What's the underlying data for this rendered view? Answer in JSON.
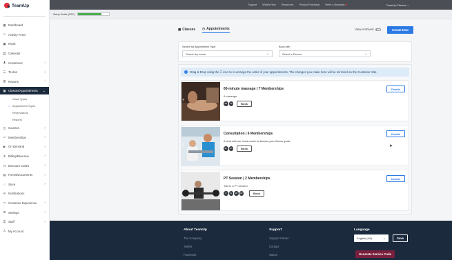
{
  "brand": {
    "name": "TeamUp"
  },
  "sidebar": {
    "items": [
      {
        "icon": "dashboard-icon",
        "glyph": "▦",
        "label": "Dashboard",
        "chev": false
      },
      {
        "icon": "activity-icon",
        "glyph": "∿",
        "label": "Activity Feed",
        "chev": false
      },
      {
        "icon": "kiosk-icon",
        "glyph": "▣",
        "label": "Kiosk",
        "chev": false
      },
      {
        "icon": "calendar-icon",
        "glyph": "▤",
        "label": "Calendar",
        "chev": false
      },
      {
        "icon": "customers-icon",
        "glyph": "♟",
        "label": "Customers",
        "chev": true
      },
      {
        "icon": "todos-icon",
        "glyph": "☰",
        "label": "To-dos",
        "chev": true
      },
      {
        "icon": "reports-icon",
        "glyph": "▥",
        "label": "Reports",
        "chev": true
      },
      {
        "icon": "classes-icon",
        "glyph": "▦",
        "label": "Classes/Appointments",
        "chev": true,
        "active": true
      }
    ],
    "sub_items": [
      {
        "label": "Class Types",
        "checked": false
      },
      {
        "label": "Appointment Types",
        "checked": true
      },
      {
        "label": "Reservations",
        "checked": false
      },
      {
        "label": "Reports",
        "checked": false
      }
    ],
    "items_after": [
      {
        "icon": "courses-icon",
        "glyph": "◫",
        "label": "Courses",
        "chev": true
      },
      {
        "icon": "memberships-icon",
        "glyph": "▭",
        "label": "Memberships",
        "chev": true
      },
      {
        "icon": "on-demand-icon",
        "glyph": "▶",
        "label": "On Demand",
        "chev": true
      },
      {
        "icon": "billing-icon",
        "glyph": "$",
        "label": "Billing/Revenue",
        "chev": true
      },
      {
        "icon": "discount-icon",
        "glyph": "%",
        "label": "Discount Codes",
        "chev": true
      },
      {
        "icon": "forms-icon",
        "glyph": "▤",
        "label": "Forms/Documents",
        "chev": true
      },
      {
        "icon": "store-icon",
        "glyph": "⌂",
        "label": "Store",
        "chev": true
      },
      {
        "icon": "notifications-icon",
        "glyph": "✉",
        "label": "Notifications",
        "chev": false
      },
      {
        "icon": "customer-experience-icon",
        "glyph": "▭",
        "label": "Customer Experience",
        "chev": true
      },
      {
        "icon": "settings-icon",
        "glyph": "⚙",
        "label": "Settings",
        "chev": true
      },
      {
        "icon": "staff-icon",
        "glyph": "⚿",
        "label": "Staff",
        "chev": true
      },
      {
        "icon": "account-icon",
        "glyph": "♙",
        "label": "My Account",
        "chev": false
      }
    ]
  },
  "topbar": {
    "links": [
      "Support",
      "What's New",
      "Resources",
      "Product Feedback",
      "Refer a Business"
    ],
    "account": "TeamUp Fitness"
  },
  "setup": {
    "label": "Setup Guide (9/12)",
    "progress": 0.75,
    "progress_color": "#4cae4f"
  },
  "tabs": {
    "classes": "Classes",
    "appointments": "Appointments"
  },
  "archived_label": "View Archived",
  "create_label": "Create New",
  "filters": {
    "type_label": "Search by Appointment Type",
    "type_value": "Search by name",
    "book_label": "Book with",
    "book_value": "Select a Person"
  },
  "info": "Drag & Drop using the ⠿ icon to re-arrange the order of your appointments. The changes you make here will be mirrored on the Customer Site.",
  "cards": [
    {
      "title": "60-minute massage",
      "memberships": "7 Memberships",
      "desc": "A massage",
      "avatars": [
        "AB",
        "CD"
      ],
      "book": "Book",
      "details": "Details"
    },
    {
      "title": "Consultation",
      "memberships": "6 Memberships",
      "desc": "A chat with our head coach to discuss your fitness goals.",
      "avatars": [
        "EF",
        "GH"
      ],
      "book": "Book",
      "details": "Details"
    },
    {
      "title": "PT Session",
      "memberships": "2 Memberships",
      "desc": "This is a PT session",
      "avatars": [
        "IJ",
        "KL",
        "MN",
        "OP"
      ],
      "book": "Book",
      "details": "Details"
    }
  ],
  "footer": {
    "about_title": "About TeamUp",
    "about_links": [
      "The Company",
      "Twitter",
      "Facebook"
    ],
    "support_title": "Support",
    "support_links": [
      "Support Center",
      "Contact",
      "Status"
    ],
    "language_title": "Language",
    "language_value": "English (UK)",
    "save_label": "Save",
    "generate_label": "Generate Service Code"
  },
  "colors": {
    "primary": "#2c7be5",
    "navy": "#1b2a3d",
    "brand_red": "#e0303c",
    "maroon": "#7a1f3d"
  }
}
